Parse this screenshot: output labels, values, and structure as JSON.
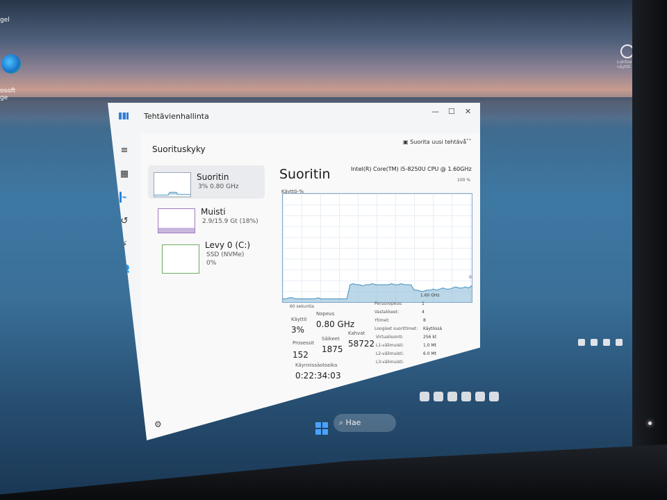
{
  "desktop": {
    "top_label": "gel",
    "icon_label": "osoft\nge",
    "top_right_label": "Lukitse\nnäyttö",
    "search_placeholder": "Hae"
  },
  "window": {
    "title": "Tehtävienhallinta",
    "controls": {
      "minimize": "—",
      "maximize": "☐",
      "close": "✕"
    },
    "page_title": "Suorituskyky",
    "run_new_task": "Suorita uusi tehtävä",
    "more": "···"
  },
  "nav": {
    "items": [
      {
        "icon": "hamburger-menu-icon",
        "glyph": "≡"
      },
      {
        "icon": "processes-icon",
        "glyph": "▦"
      },
      {
        "icon": "performance-icon",
        "glyph": "⌁"
      },
      {
        "icon": "app-history-icon",
        "glyph": "↺"
      },
      {
        "icon": "startup-apps-icon",
        "glyph": "⚡"
      },
      {
        "icon": "users-icon",
        "glyph": "👥"
      },
      {
        "icon": "details-icon",
        "glyph": "☰"
      },
      {
        "icon": "services-icon",
        "glyph": "⚙"
      }
    ],
    "settings_glyph": "⚙"
  },
  "perf_list": [
    {
      "name": "Suoritin",
      "sub": "3% 0.80 GHz"
    },
    {
      "name": "Muisti",
      "sub": "2.9/15.9 Gt (18%)"
    },
    {
      "name": "Levy 0 (C:)",
      "sub": "SSD (NVMe)",
      "sub2": "0%"
    }
  ],
  "cpu": {
    "title": "Suoritin",
    "model": "Intel(R) Core(TM) i5-8250U CPU @ 1.60GHz",
    "usage_label": "Käyttö-%",
    "max_label": "100 %",
    "min_label": "0",
    "time_label": "60 sekuntia",
    "usage_label_small": "Käyttö",
    "usage_value": "3%",
    "speed_label": "Nopeus",
    "speed_value": "0.80 GHz",
    "processes_label": "Prosessit",
    "processes_value": "152",
    "threads_label": "Säikeet",
    "threads_value": "1875",
    "handles_label": "Kahvat",
    "handles_value": "58722",
    "uptime_label": "Käynnissäoloaika",
    "uptime_value": "0:22:34:03",
    "specs": [
      {
        "label": "Perusnopeus:",
        "value": "1.60 GHz"
      },
      {
        "label": "Vastakkeet:",
        "value": "1"
      },
      {
        "label": "Ytimet:",
        "value": "4"
      },
      {
        "label": "Loogiset suorittimet:",
        "value": "8"
      },
      {
        "label": "Virtualisointi:",
        "value": "Käytössä"
      },
      {
        "label": "L1-välimuisti:",
        "value": "256 kt"
      },
      {
        "label": "L2-välimuisti:",
        "value": "1.0 Mt"
      },
      {
        "label": "L3-välimuisti:",
        "value": "6.0 Mt"
      }
    ]
  },
  "chart_data": {
    "type": "area",
    "title": "Suoritin",
    "ylabel": "Käyttö-%",
    "xlabel": "60 sekuntia",
    "ylim": [
      0,
      100
    ],
    "series": [
      {
        "values": [
          3,
          3,
          4,
          4,
          3,
          3,
          3,
          3,
          3,
          3,
          3,
          4,
          3,
          3,
          3,
          3,
          3,
          3,
          3,
          3,
          3,
          16,
          17,
          16,
          16,
          15,
          16,
          16,
          17,
          16,
          16,
          16,
          16,
          16,
          17,
          16,
          16,
          17,
          16,
          16,
          16,
          11,
          11,
          10,
          10,
          11,
          11,
          12,
          11,
          12,
          13,
          12,
          12,
          13,
          14,
          13,
          13,
          14,
          13,
          15
        ]
      }
    ],
    "accent_color": "#8fbdd8",
    "line_color": "#3f8fbf"
  }
}
